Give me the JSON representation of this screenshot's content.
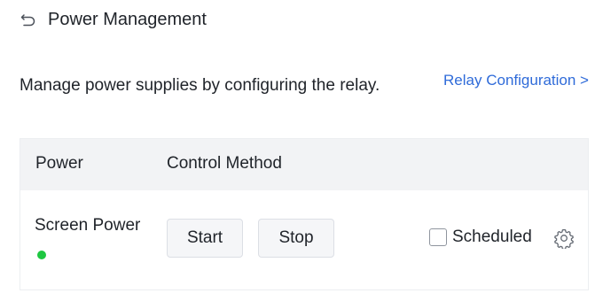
{
  "header": {
    "title": "Power Management"
  },
  "description": "Manage power supplies by configuring the relay.",
  "relay_link": "Relay Configuration >",
  "table": {
    "columns": [
      "Power",
      "Control Method"
    ],
    "rows": [
      {
        "name": "Screen Power",
        "status": "on",
        "status_color": "#1ec741",
        "start_label": "Start",
        "stop_label": "Stop",
        "scheduled_label": "Scheduled",
        "scheduled_checked": false
      }
    ]
  },
  "colors": {
    "link": "#2f6bd9",
    "header_bg": "#f2f3f5"
  },
  "icons": {
    "back": "back-arrow-icon",
    "settings": "gear-icon"
  }
}
